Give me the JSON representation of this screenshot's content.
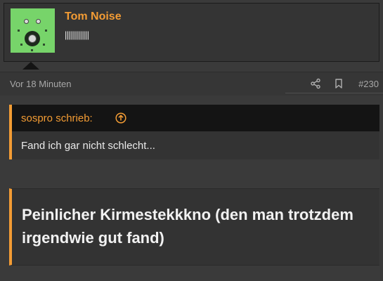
{
  "post": {
    "user": {
      "name": "Tom Noise",
      "title": "||||||||||||",
      "avatar": "guitar-effects-pedal-pcb-avatar"
    },
    "meta": {
      "time": "Vor 18 Minuten",
      "share_icon": "share-icon",
      "bookmark_icon": "bookmark-icon",
      "number": "#230"
    },
    "quote": {
      "author": "sospro schrieb:",
      "jump_icon": "arrow-up-circle-icon",
      "text": "Fand ich gar nicht schlecht..."
    },
    "heading": "Peinlicher Kirmestekkkno (den man trotzdem irgendwie gut fand)"
  },
  "colors": {
    "accent": "#f39c34",
    "background": "#3a3a3a",
    "quote_header": "#141414"
  }
}
